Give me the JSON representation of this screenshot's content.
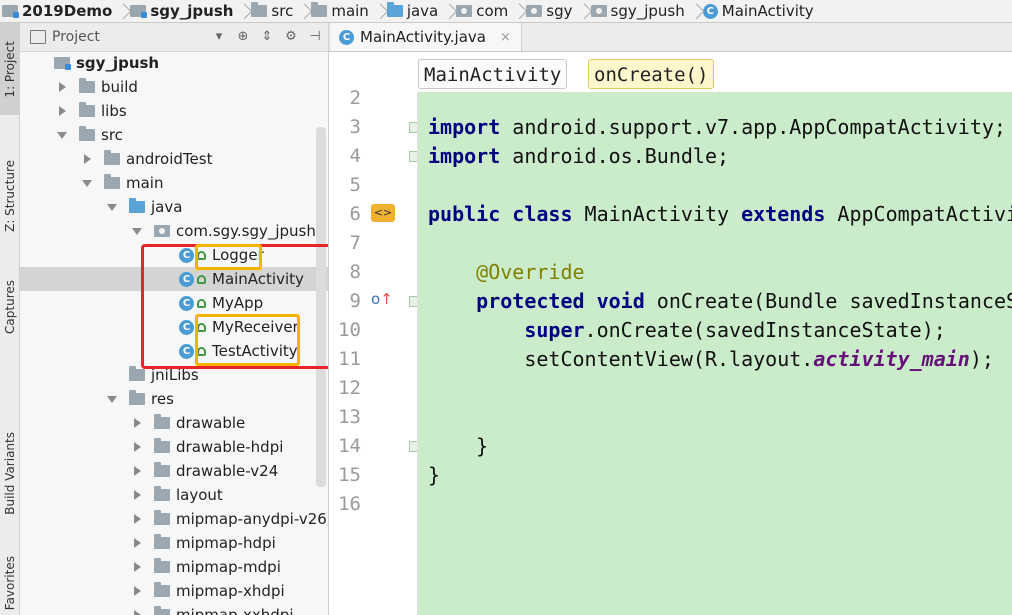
{
  "breadcrumb": [
    "2019Demo",
    "sgy_jpush",
    "src",
    "main",
    "java",
    "com",
    "sgy",
    "sgy_jpush",
    "MainActivity"
  ],
  "tool_strip": {
    "project_tab": "1: Project",
    "structure_tab": "Z: Structure",
    "captures_tab": "Captures",
    "build_variants_tab": "Build Variants",
    "favorites_tab": "Favorites"
  },
  "project_panel": {
    "title": "Project",
    "tree": [
      {
        "label": "sgy_jpush",
        "depth": 0,
        "arrow": "none",
        "icon": "module-icon",
        "bold": true
      },
      {
        "label": "build",
        "depth": 1,
        "arrow": "right",
        "icon": "folder-icon"
      },
      {
        "label": "libs",
        "depth": 1,
        "arrow": "right",
        "icon": "folder-icon"
      },
      {
        "label": "src",
        "depth": 1,
        "arrow": "down",
        "icon": "folder-icon"
      },
      {
        "label": "androidTest",
        "depth": 2,
        "arrow": "right",
        "icon": "folder-icon"
      },
      {
        "label": "main",
        "depth": 2,
        "arrow": "down",
        "icon": "folder-icon"
      },
      {
        "label": "java",
        "depth": 3,
        "arrow": "down",
        "icon": "folder-icon-blue"
      },
      {
        "label": "com.sgy.sgy_jpush",
        "depth": 4,
        "arrow": "down",
        "icon": "package-icon"
      },
      {
        "label": "Logger",
        "depth": 5,
        "arrow": "none",
        "icon": "class-icon"
      },
      {
        "label": "MainActivity",
        "depth": 5,
        "arrow": "none",
        "icon": "class-icon",
        "selected": true
      },
      {
        "label": "MyApp",
        "depth": 5,
        "arrow": "none",
        "icon": "class-icon"
      },
      {
        "label": "MyReceiver",
        "depth": 5,
        "arrow": "none",
        "icon": "class-icon"
      },
      {
        "label": "TestActivity",
        "depth": 5,
        "arrow": "none",
        "icon": "class-icon"
      },
      {
        "label": "jniLibs",
        "depth": 3,
        "arrow": "none",
        "icon": "folder-icon"
      },
      {
        "label": "res",
        "depth": 3,
        "arrow": "down",
        "icon": "folder-icon"
      },
      {
        "label": "drawable",
        "depth": 4,
        "arrow": "right",
        "icon": "folder-icon"
      },
      {
        "label": "drawable-hdpi",
        "depth": 4,
        "arrow": "right",
        "icon": "folder-icon"
      },
      {
        "label": "drawable-v24",
        "depth": 4,
        "arrow": "right",
        "icon": "folder-icon"
      },
      {
        "label": "layout",
        "depth": 4,
        "arrow": "right",
        "icon": "folder-icon"
      },
      {
        "label": "mipmap-anydpi-v26",
        "depth": 4,
        "arrow": "right",
        "icon": "folder-icon"
      },
      {
        "label": "mipmap-hdpi",
        "depth": 4,
        "arrow": "right",
        "icon": "folder-icon"
      },
      {
        "label": "mipmap-mdpi",
        "depth": 4,
        "arrow": "right",
        "icon": "folder-icon"
      },
      {
        "label": "mipmap-xhdpi",
        "depth": 4,
        "arrow": "right",
        "icon": "folder-icon"
      },
      {
        "label": "mipmap-xxhdpi",
        "depth": 4,
        "arrow": "right",
        "icon": "folder-icon"
      }
    ]
  },
  "editor": {
    "tab_label": "MainActivity.java",
    "crumb_class": "MainActivity",
    "crumb_method": "onCreate()",
    "line_numbers": [
      "2",
      "3",
      "4",
      "5",
      "6",
      "7",
      "8",
      "9",
      "10",
      "11",
      "12",
      "13",
      "14",
      "15",
      "16"
    ],
    "lines": [
      [],
      [
        {
          "t": "import",
          "c": "kw"
        },
        {
          "t": " android.support.v7.app.AppCompatActivity;"
        }
      ],
      [
        {
          "t": "import",
          "c": "kw"
        },
        {
          "t": " android.os.Bundle;"
        }
      ],
      [],
      [
        {
          "t": "public",
          "c": "kw"
        },
        {
          "t": " "
        },
        {
          "t": "class",
          "c": "kw"
        },
        {
          "t": " MainActivity "
        },
        {
          "t": "extends",
          "c": "kw"
        },
        {
          "t": " AppCompatActivity {"
        }
      ],
      [],
      [
        {
          "t": "    "
        },
        {
          "t": "@Override",
          "c": "ann"
        }
      ],
      [
        {
          "t": "    "
        },
        {
          "t": "protected",
          "c": "kw"
        },
        {
          "t": " "
        },
        {
          "t": "void",
          "c": "kw"
        },
        {
          "t": " onCreate(Bundle savedInstanceState) {"
        }
      ],
      [
        {
          "t": "        "
        },
        {
          "t": "super",
          "c": "kw"
        },
        {
          "t": ".onCreate(savedInstanceState);"
        }
      ],
      [
        {
          "t": "        setContentView(R.layout."
        },
        {
          "t": "activity_main",
          "c": "it"
        },
        {
          "t": ");"
        }
      ],
      [],
      [],
      [
        {
          "t": "    }"
        }
      ],
      [
        {
          "t": "}"
        }
      ],
      []
    ]
  },
  "colors": {
    "highlight_red": "#e8242a",
    "highlight_orange": "#f5b300",
    "code_background": "#cbeccb",
    "keyword": "#000080"
  }
}
